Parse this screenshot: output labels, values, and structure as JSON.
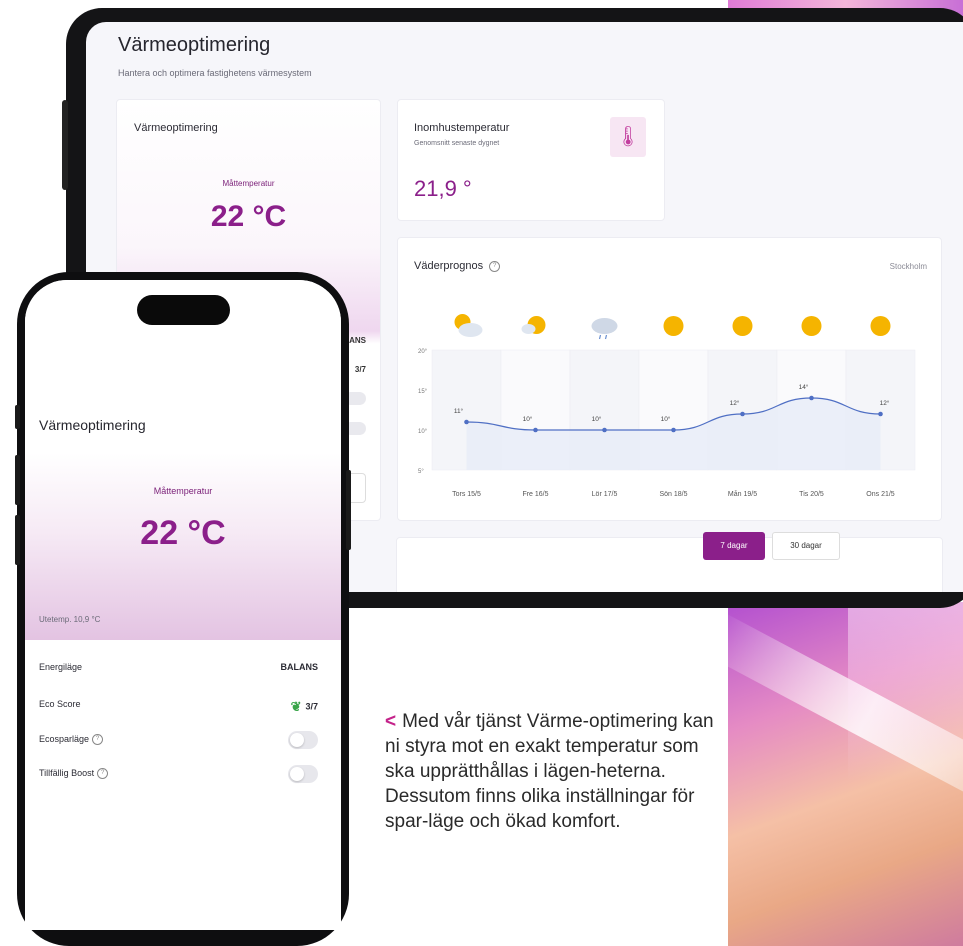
{
  "tablet": {
    "title": "Värmeoptimering",
    "subtitle": "Hantera och optimera fastighetens värmesystem",
    "varme_card": {
      "heading": "Värmeoptimering",
      "measure_label": "Måttemperatur",
      "measure_value": "22 °C",
      "frag_mode": "ANS",
      "frag_score": "3/7"
    },
    "indoor_card": {
      "heading": "Inomhustemperatur",
      "subheading": "Genomsnitt senaste dygnet",
      "value": "21,9 °",
      "icon": "thermometer-icon"
    },
    "weather_card": {
      "heading": "Väderprognos",
      "location": "Stockholm"
    },
    "buttons": {
      "days7": "7 dagar",
      "days30": "30 dagar"
    }
  },
  "chart_data": {
    "type": "line",
    "categories": [
      "Tors 15/5",
      "Fre 16/5",
      "Lör 17/5",
      "Sön 18/5",
      "Mån 19/5",
      "Tis 20/5",
      "Ons 21/5"
    ],
    "series": [
      {
        "values": [
          11,
          10,
          10,
          10,
          12,
          14,
          12
        ]
      }
    ],
    "data_labels": [
      "11°",
      "10°",
      "10°",
      "10°",
      "12°",
      "14°",
      "12°"
    ],
    "weather_icons": [
      "partly-cloudy-icon",
      "partly-sunny-icon",
      "rain-cloud-icon",
      "sun-icon",
      "sun-icon",
      "sun-icon",
      "sun-icon"
    ],
    "yticks": [
      "20°",
      "15°",
      "10°",
      "5°"
    ],
    "ylim": [
      5,
      20
    ],
    "grid": true,
    "colors": {
      "line": "#4f6fc4",
      "fill": "#e7ecf8"
    }
  },
  "phone": {
    "title": "Värmeoptimering",
    "measure_label": "Måttemperatur",
    "measure_value": "22 °C",
    "outdoor": "Utetemp. 10,9 °C",
    "rows": [
      {
        "label": "Energiläge",
        "value": "BALANS"
      },
      {
        "label": "Eco Score",
        "value": "3/7"
      },
      {
        "label": "Ecosparläge"
      },
      {
        "label": "Tillfällig Boost"
      }
    ]
  },
  "caption": {
    "text": "Med vår tjänst Värme-optimering kan ni styra mot en exakt temperatur som ska upprätthållas i lägen-heterna. Dessutom finns olika inställningar för spar-läge och ökad komfort."
  },
  "colors": {
    "accent": "#8b1f8a",
    "caption_arrow": "#c4238a"
  }
}
